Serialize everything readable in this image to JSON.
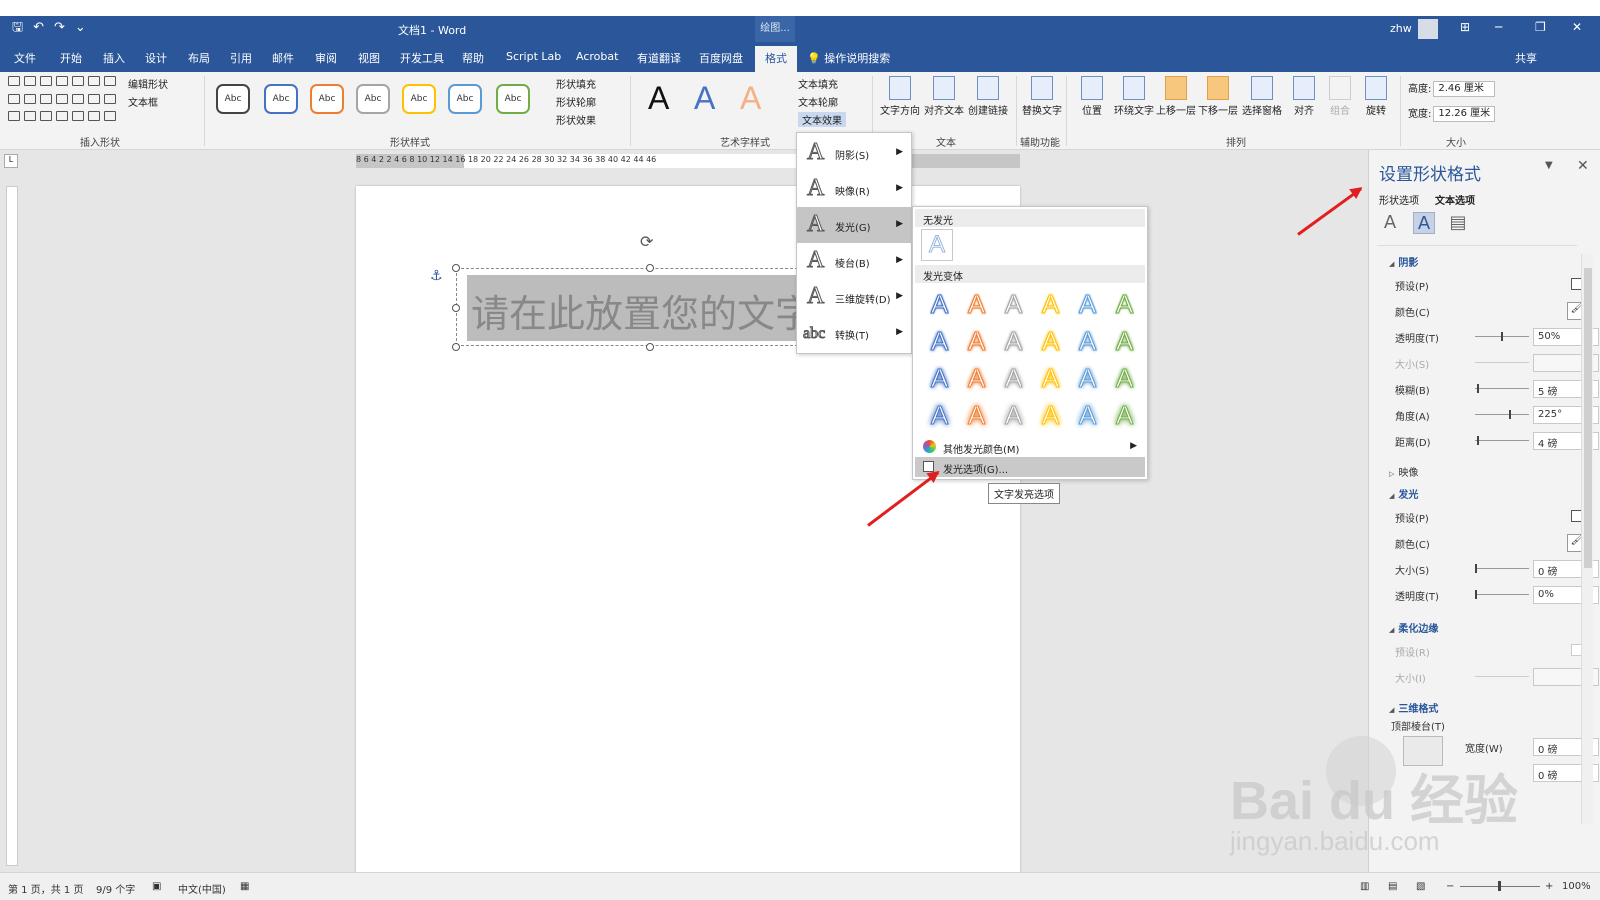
{
  "titlebar": {
    "doc_title": "文档1 - Word",
    "context_tab_head": "绘图...",
    "user": "zhw",
    "qat": [
      "🖫",
      "↶",
      "↷",
      "⌄"
    ],
    "window_buttons": [
      "⊞",
      "─",
      "❐",
      "✕"
    ]
  },
  "tabs": {
    "items": [
      "文件",
      "开始",
      "插入",
      "设计",
      "布局",
      "引用",
      "邮件",
      "审阅",
      "视图",
      "开发工具",
      "帮助",
      "Script Lab",
      "Acrobat",
      "有道翻译",
      "百度网盘",
      "格式"
    ],
    "tell_me": "操作说明搜索",
    "share": "共享"
  },
  "ribbon": {
    "edit_shape": "编辑形状",
    "text_box": "文本框",
    "group_insert_shape": "插入形状",
    "abc": "Abc",
    "shape_fill": "形状填充",
    "shape_outline": "形状轮廓",
    "shape_effect": "形状效果",
    "group_shape_style": "形状样式",
    "wordart_a": "A",
    "group_wordart": "艺术字样式",
    "text_fill": "文本填充",
    "text_outline": "文本轮廓",
    "text_effect": "文本效果",
    "text_direction": "文字方向",
    "align_text": "对齐文本",
    "create_link": "创建链接",
    "group_text": "文本",
    "alt_text": "替换文字",
    "group_accessibility": "辅助功能",
    "position": "位置",
    "wrap_text": "环绕文字",
    "bring_forward": "上移一层",
    "send_backward": "下移一层",
    "selection_pane": "选择窗格",
    "align": "对齐",
    "group": "组合",
    "rotate": "旋转",
    "group_arrange": "排列",
    "height_label": "高度:",
    "height_value": "2.46 厘米",
    "width_label": "宽度:",
    "width_value": "12.26 厘米",
    "group_size": "大小"
  },
  "ruler": {
    "corner": "L",
    "ticks": "8 6 4 2   2 4 6 8 10 12 14 16 18 20 22 24 26 28 30 32 34 36 38 40 42 44 46"
  },
  "document": {
    "placeholder_text": "请在此放置您的文字"
  },
  "text_effects_menu": {
    "items": [
      {
        "label": "阴影(S)",
        "glyph": "A"
      },
      {
        "label": "映像(R)",
        "glyph": "A"
      },
      {
        "label": "发光(G)",
        "glyph": "A"
      },
      {
        "label": "棱台(B)",
        "glyph": "A"
      },
      {
        "label": "三维旋转(D)",
        "glyph": "A"
      },
      {
        "label": "转换(T)",
        "glyph": "abc"
      }
    ],
    "highlighted": "发光(G)"
  },
  "glow_submenu": {
    "no_glow_header": "无发光",
    "variants_header": "发光变体",
    "glyph": "A",
    "colors": [
      "#4472c4",
      "#ed7d31",
      "#a5a5a5",
      "#ffc000",
      "#5b9bd5",
      "#70ad47"
    ],
    "more_colors": "其他发光颜色(M)",
    "glow_options": "发光选项(G)...",
    "tooltip": "文字发亮选项"
  },
  "format_pane": {
    "title": "设置形状格式",
    "tab_shape": "形状选项",
    "tab_text": "文本选项",
    "shadow": {
      "header": "阴影",
      "preset": "预设(P)",
      "color": "颜色(C)",
      "transparency": "透明度(T)",
      "transparency_value": "50%",
      "size": "大小(S)",
      "blur": "模糊(B)",
      "blur_value": "5 磅",
      "angle": "角度(A)",
      "angle_value": "225°",
      "distance": "距离(D)",
      "distance_value": "4 磅"
    },
    "reflection": {
      "header": "映像"
    },
    "glow": {
      "header": "发光",
      "preset": "预设(P)",
      "color": "颜色(C)",
      "size": "大小(S)",
      "size_value": "0 磅",
      "transparency": "透明度(T)",
      "transparency_value": "0%"
    },
    "soft_edges": {
      "header": "柔化边缘",
      "preset": "预设(R)",
      "size": "大小(I)"
    },
    "three_d": {
      "header": "三维格式",
      "top_bevel": "顶部棱台(T)",
      "width": "宽度(W)",
      "width_value": "0 磅",
      "height_value": "0 磅"
    }
  },
  "statusbar": {
    "page": "第 1 页，共 1 页",
    "words": "9/9 个字",
    "lang": "中文(中国)",
    "zoom": "100%"
  },
  "watermark": {
    "line1": "Bai du 经验",
    "line2": "jingyan.baidu.com"
  },
  "colors": {
    "brand": "#2b579a",
    "arrow": "#e02020"
  }
}
